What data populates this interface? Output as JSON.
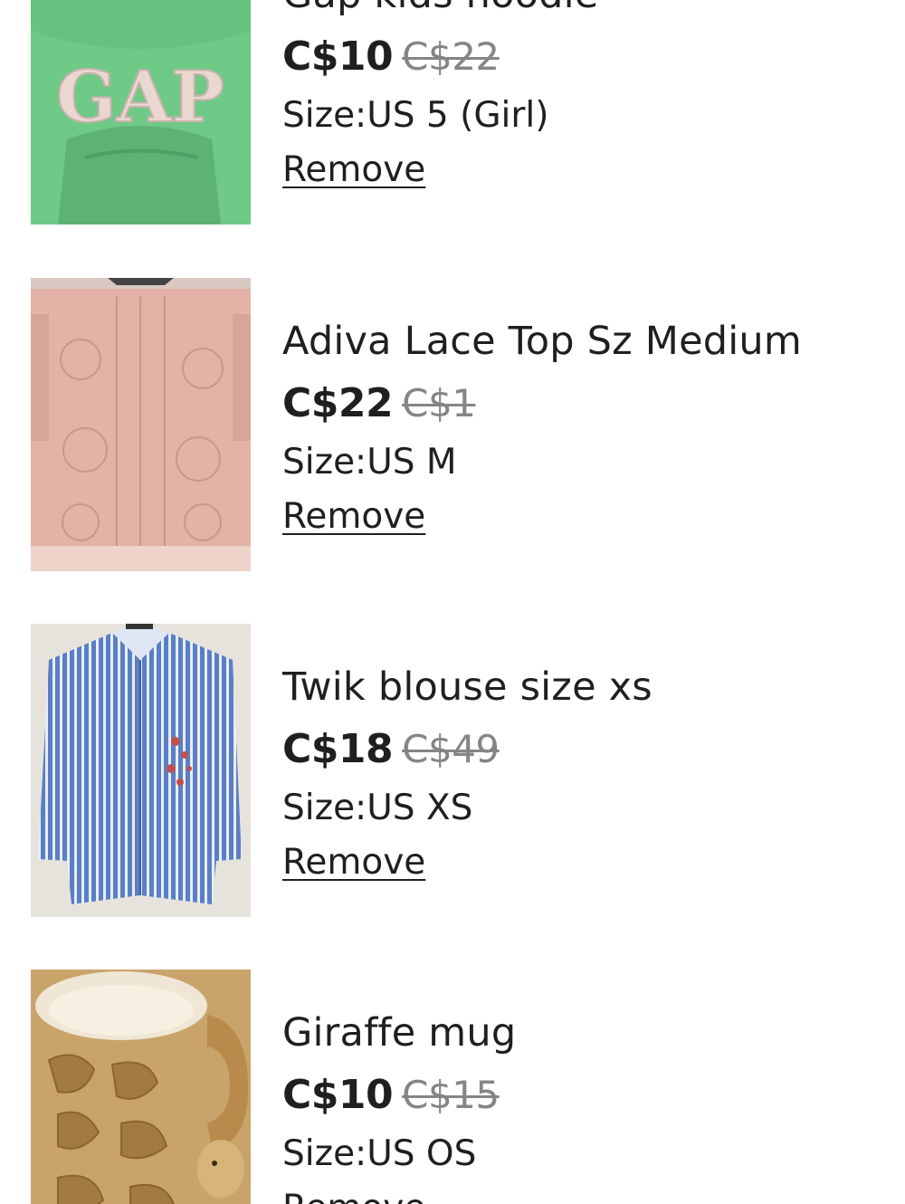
{
  "items": [
    {
      "title": "Gap kids hoodie",
      "price": "C$10",
      "original_price": "C$22",
      "size_label": "Size:",
      "size_value": "US 5 (Girl)",
      "remove_label": "Remove",
      "image_icon": "green-gap-hoodie-photo"
    },
    {
      "title": "Adiva Lace Top Sz Medium",
      "price": "C$22",
      "original_price": "C$1",
      "size_label": "Size:",
      "size_value": "US M",
      "remove_label": "Remove",
      "image_icon": "pink-lace-top-photo"
    },
    {
      "title": "Twik blouse size xs",
      "price": "C$18",
      "original_price": "C$49",
      "size_label": "Size:",
      "size_value": "US XS",
      "remove_label": "Remove",
      "image_icon": "blue-striped-blouse-photo"
    },
    {
      "title": "Giraffe mug",
      "price": "C$10",
      "original_price": "C$15",
      "size_label": "Size:",
      "size_value": "US OS",
      "remove_label": "Remove",
      "image_icon": "giraffe-mug-photo"
    }
  ],
  "colors": {
    "text": "#1f1f1f",
    "strikethrough_price": "#858585",
    "background": "#ffffff"
  }
}
